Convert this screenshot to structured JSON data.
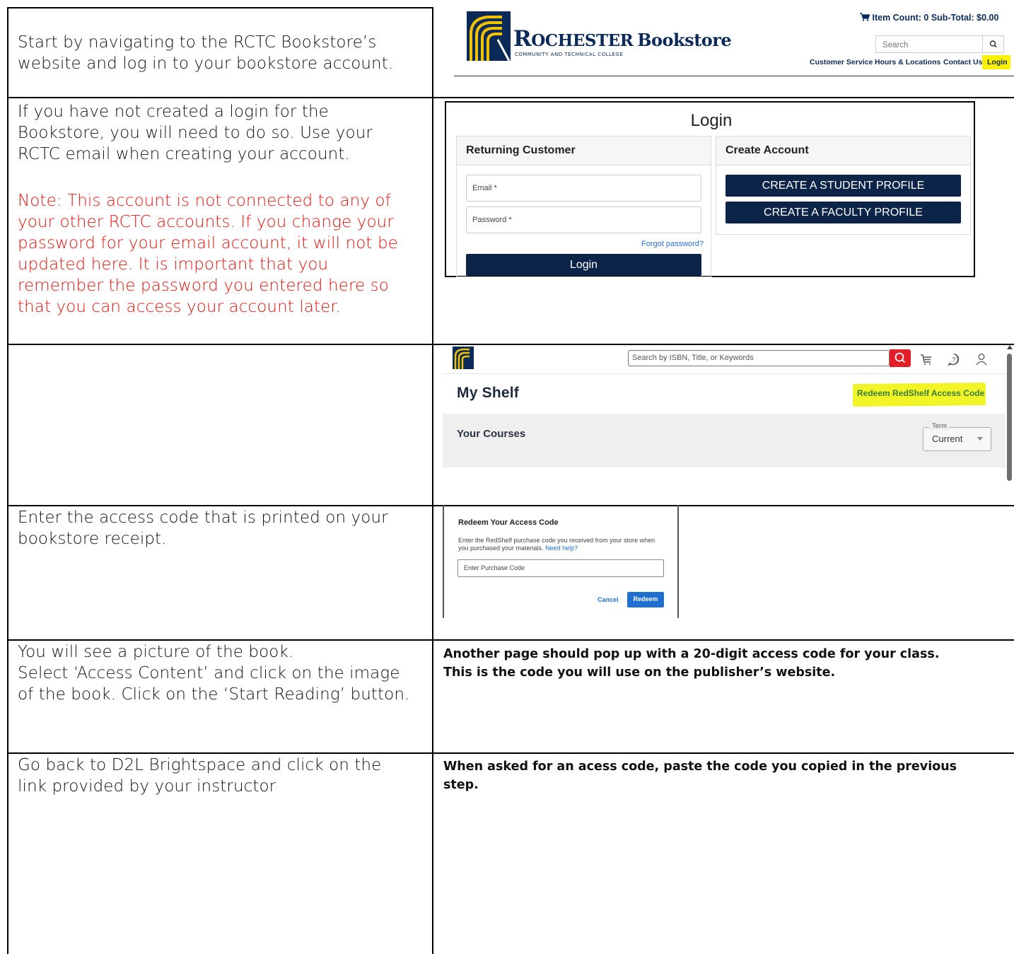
{
  "rows": {
    "r1": {
      "left": "Start by navigating to the RCTC Bookstore’s website and log in to your bookstore account.",
      "left_lines": [
        "Start by navigating to the RCTC Bookstore’s",
        "website and log in to your bookstore account."
      ]
    },
    "r2": {
      "left_lines": [
        "If you have not created a login for the",
        "Bookstore, you will need to do so.  Use your",
        "RCTC email when creating your account."
      ],
      "note_lines": [
        "Note:  This account is not connected to any of",
        "your other RCTC accounts.  If you change your",
        "password for your email account, it will not be",
        "updated here.  It is important that you",
        "remember the password you entered here so",
        "that you can access your account later."
      ]
    },
    "r4": {
      "left_lines": [
        "Enter the access code that is printed on your",
        "bookstore receipt."
      ]
    },
    "r5": {
      "left_lines": [
        "You will see a picture of the book.",
        "Select ‘Access Content’ and click on the image",
        "of the book.  Click on the ‘Start Reading’ button."
      ],
      "right_lines": [
        "Another page should pop up with a 20-digit access code for your class.",
        "This is the code you will use on the publisher’s website."
      ]
    },
    "r6": {
      "left_lines": [
        "Go back to D2L Brightspace and click on the",
        "link provided by your instructor"
      ],
      "right_lines": [
        "When asked for an acess code, paste the code you copied in the previous",
        "step."
      ]
    }
  },
  "bookstore": {
    "brand_r": "R",
    "brand_ochester": "OCHESTER",
    "brand_bookstore": "Bookstore",
    "brand_sub": "COMMUNITY AND TECHNICAL COLLEGE",
    "cart": "Item Count: 0  Sub-Total: $0.00",
    "search_placeholder": "Search",
    "nav": [
      "Customer Service",
      "Hours & Locations",
      "Contact Us",
      "Login"
    ],
    "brand_color": "#0b2a57",
    "highlight_color": "#fff200"
  },
  "login": {
    "title": "Login",
    "returning_header": "Returning Customer",
    "email_label": "Email *",
    "password_label": "Password *",
    "forgot": "Forgot password?",
    "login_button": "Login",
    "create_header": "Create Account",
    "student_button": "CREATE A STUDENT PROFILE",
    "faculty_button": "CREATE A FACULTY PROFILE",
    "button_color": "#0b2447"
  },
  "shelf": {
    "search_placeholder": "Search by ISBN, Title, or Keywords",
    "title": "My Shelf",
    "redeem_link": "Redeem RedShelf Access Code",
    "courses": "Your Courses",
    "term_label": "Term",
    "term_value": "Current",
    "search_button_color": "#e31e26"
  },
  "redeem": {
    "title": "Redeem Your Access Code",
    "desc_line1": "Enter the RedShelf purchase code you received from your store when",
    "desc_line2": "you purchased your materials.",
    "help": "Need help?",
    "input_placeholder": "Enter Purchase Code",
    "cancel": "Cancel",
    "redeem": "Redeem",
    "accent": "#1f6fd1"
  }
}
